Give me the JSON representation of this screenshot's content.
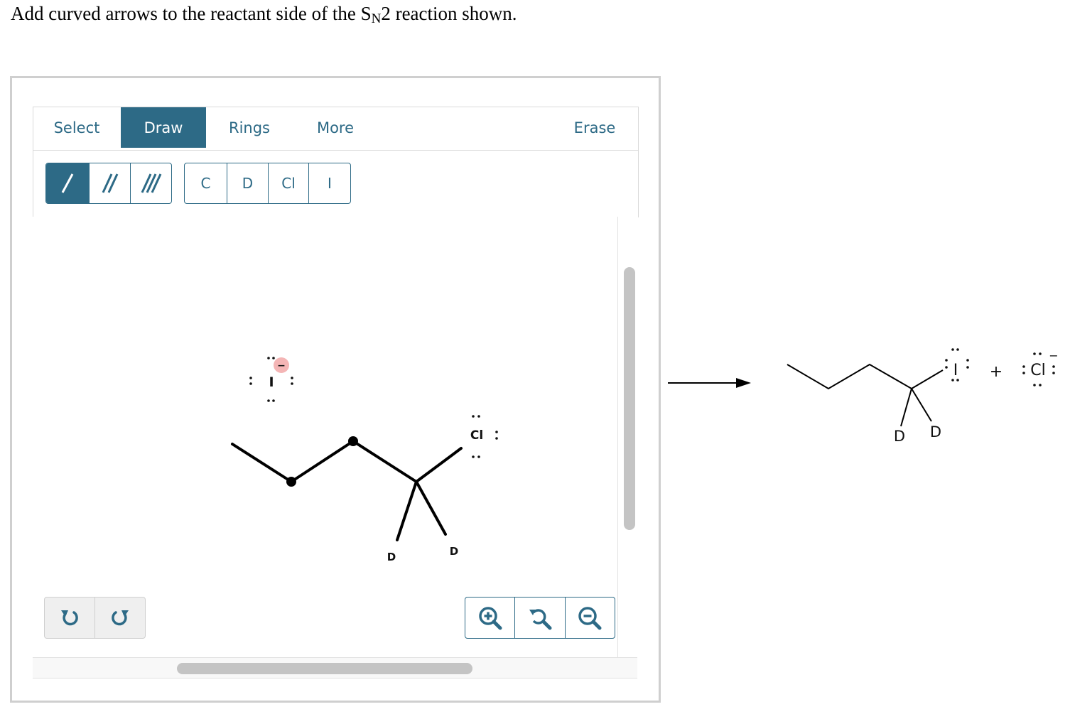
{
  "question": {
    "prefix": "Add curved arrows to the reactant side of the S",
    "subscript": "N",
    "suffix": "2 reaction shown."
  },
  "tabs": [
    {
      "label": "Select",
      "active": false
    },
    {
      "label": "Draw",
      "active": true
    },
    {
      "label": "Rings",
      "active": false
    },
    {
      "label": "More",
      "active": false
    },
    {
      "label": "Erase",
      "active": false
    }
  ],
  "bond_tools": [
    {
      "icon": "single-bond-icon",
      "active": true
    },
    {
      "icon": "double-bond-icon",
      "active": false
    },
    {
      "icon": "triple-bond-icon",
      "active": false
    }
  ],
  "atom_tools": [
    "C",
    "D",
    "Cl",
    "I"
  ],
  "history": {
    "undo_icon": "undo-icon",
    "redo_icon": "redo-icon"
  },
  "zoom": {
    "zoom_in_icon": "zoom-in-icon",
    "reset_icon": "zoom-reset-icon",
    "zoom_out_icon": "zoom-out-icon"
  },
  "reactant": {
    "nucleophile_label": "I",
    "charge": "−",
    "leaving_group_label": "Cl",
    "deuterium_left": "D",
    "deuterium_right": "D"
  },
  "product": {
    "iodine_label": "I",
    "deuterium_left": "D",
    "deuterium_right": "D",
    "plus": "+",
    "chloride_label": "Cl",
    "chloride_charge": "−"
  },
  "colors": {
    "accent": "#2d6a86",
    "charge_badge": "#f4b5b5",
    "frame": "#cfcfcf"
  }
}
